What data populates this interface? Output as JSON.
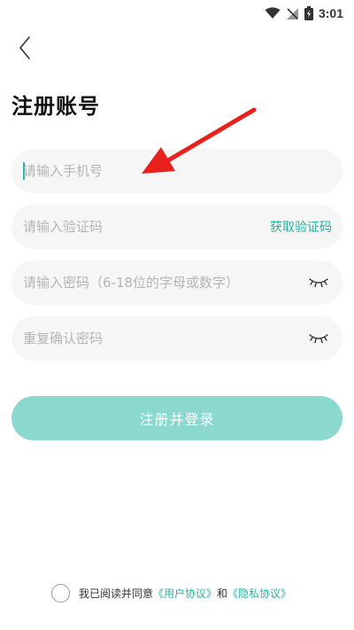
{
  "status_bar": {
    "time": "3:01",
    "icons": [
      "wifi-icon",
      "no-sim-icon",
      "battery-icon"
    ]
  },
  "header": {
    "back_icon": "chevron-left-icon",
    "title": "注册账号"
  },
  "form": {
    "phone": {
      "placeholder": "请输入手机号",
      "value": ""
    },
    "code": {
      "placeholder": "请输入验证码",
      "value": "",
      "get_code_label": "获取验证码"
    },
    "password": {
      "placeholder": "请输入密码（6-18位的字母或数字）",
      "value": "",
      "icon": "eye-closed-icon"
    },
    "confirm": {
      "placeholder": "重复确认密码",
      "value": "",
      "icon": "eye-closed-icon"
    },
    "submit_label": "注册并登录"
  },
  "agreement": {
    "checked": false,
    "prefix": "我已阅读并同意",
    "user_agreement": "《用户协议》",
    "and": "和",
    "privacy_policy": "《隐私协议》"
  },
  "annotation": {
    "icon": "red-arrow-icon",
    "color": "#e8211d"
  },
  "colors": {
    "accent": "#26b3a3",
    "button": "#8bd8cf",
    "field_bg": "#f6f6f6"
  }
}
